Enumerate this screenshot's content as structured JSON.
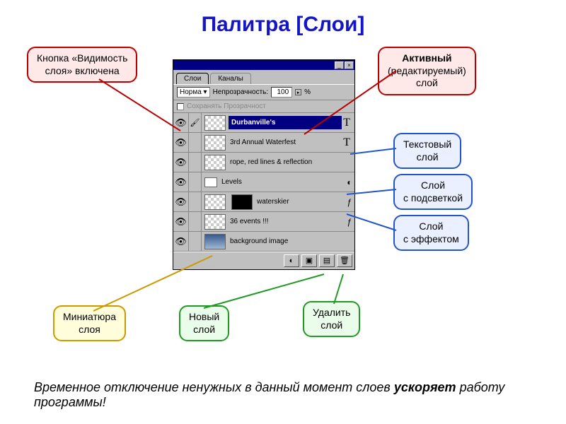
{
  "title": "Палитра [Слои]",
  "panel": {
    "tabs": {
      "layers": "Слои",
      "channels": "Каналы"
    },
    "mode": "Норма",
    "opacity_label": "Непрозрачность:",
    "opacity_value": "100",
    "opacity_pct": "%",
    "preserve": "Сохранять Прозрачност",
    "rows": [
      {
        "name": "Durbanville's",
        "type": "text_active"
      },
      {
        "name": "3rd Annual Waterfest",
        "type": "text"
      },
      {
        "name": "rope, red lines & reflection",
        "type": "plain"
      },
      {
        "name": "Levels",
        "type": "adjust"
      },
      {
        "name": "waterskier",
        "type": "fx"
      },
      {
        "name": "36 events !!!",
        "type": "fx2"
      },
      {
        "name": "background image",
        "type": "img"
      }
    ]
  },
  "callouts": {
    "visibility": {
      "l1": "Кнопка «Видимость",
      "l2": "слоя» включена"
    },
    "active": {
      "l1": "Активный",
      "l2": "(редактируемый)",
      "l3": "слой"
    },
    "text": {
      "l1": "Текстовый",
      "l2": "слой"
    },
    "highlight": {
      "l1": "Слой",
      "l2": "с подсветкой"
    },
    "effect": {
      "l1": "Слой",
      "l2": "с эффектом"
    },
    "mini": {
      "l1": "Миниатюра",
      "l2": "слоя"
    },
    "new": {
      "l1": "Новый",
      "l2": "слой"
    },
    "delete": {
      "l1": "Удалить",
      "l2": "слой"
    }
  },
  "footer": {
    "pre": "Временное отключение ненужных в данный момент слоев ",
    "bold": "ускоряет",
    "post": " работу программы!"
  }
}
